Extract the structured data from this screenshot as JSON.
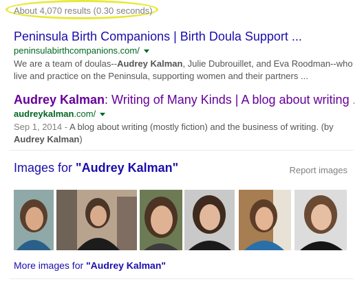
{
  "search_stats": "About 4,070 results (0.30 seconds)",
  "results": [
    {
      "title": "Peninsula Birth Companions | Birth Doula Support ...",
      "url": "peninsulabirthcompanions.com/",
      "snippet_pre": "We are a team of doulas--",
      "snippet_bold": "Audrey Kalman",
      "snippet_post": ", Julie Dubrouillet, and Eva Roodman--who live and practice on the Peninsula, supporting women and their partners ..."
    },
    {
      "title_bold": "Audrey Kalman",
      "title_rest": ": Writing of Many Kinds | A blog about writing ...",
      "url_bold": "audreykalman",
      "url_rest": ".com/",
      "date": "Sep 1, 2014 - ",
      "snippet_pre": "A blog about writing (mostly fiction) and the business of writing. (by ",
      "snippet_bold": "Audrey Kalman",
      "snippet_post": ")"
    }
  ],
  "images_section": {
    "heading_prefix": "Images for ",
    "heading_query": "\"Audrey Kalman\"",
    "report_label": "Report images",
    "more_prefix": "More images for ",
    "more_query": "\"Audrey Kalman\""
  },
  "colors": {
    "link": "#1a0dab",
    "visited": "#660099",
    "url_green": "#006621",
    "highlight": "#e8e83a"
  }
}
